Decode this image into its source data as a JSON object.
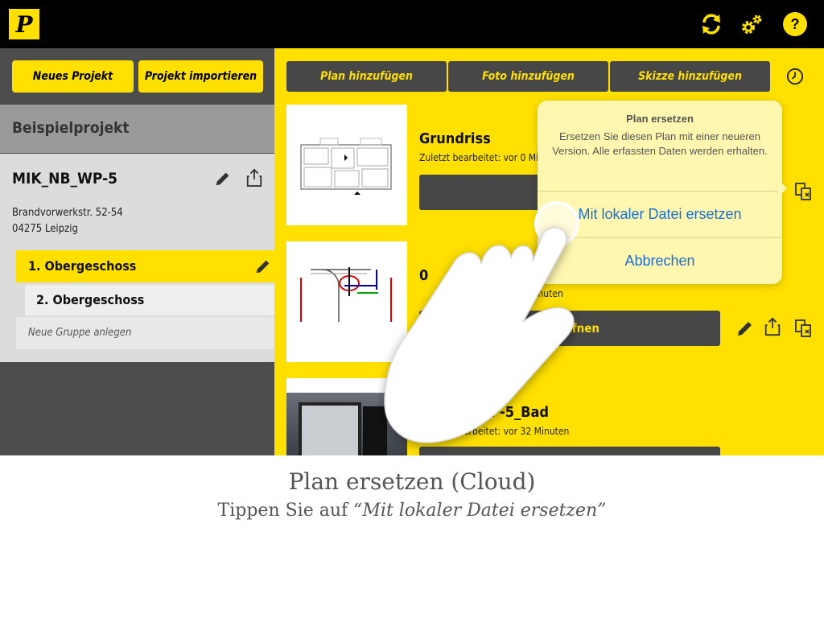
{
  "topbar": {
    "logo_letter": "P",
    "sync_icon": "sync-icon",
    "settings_icon": "gears-icon",
    "help_label": "?"
  },
  "sidebar": {
    "new_project": "Neues Projekt",
    "import_project": "Projekt importieren",
    "project_header": "Beispielprojekt",
    "project": {
      "name": "MIK_NB_WP-5",
      "address_line1": "Brandvorwerkstr. 52-54",
      "address_line2": "04275 Leipzig"
    },
    "floors": [
      {
        "label": "1. Obergeschoss",
        "selected": true
      },
      {
        "label": "2. Obergeschoss",
        "selected": false
      }
    ],
    "new_group": "Neue Gruppe anlegen"
  },
  "toolbar": {
    "add_plan": "Plan hinzufügen",
    "add_photo": "Foto hinzufügen",
    "add_sketch": "Skizze hinzufügen",
    "history_icon": "clock-icon"
  },
  "plans": [
    {
      "title": "Grundriss",
      "meta": "Zuletzt bearbeitet: vor 0 Mi"
    },
    {
      "title": "0",
      "meta": "/ Minuten",
      "open_label": "öffnen"
    },
    {
      "title": "K_NB_WP-5_Bad",
      "meta": "Zuletzt bearbeitet: vor 32 Minuten"
    }
  ],
  "popover": {
    "title": "Plan ersetzen",
    "message": "Ersetzen Sie diesen Plan mit einer neueren Version. Alle erfassten Daten werden erhalten.",
    "action_replace": "Mit lokaler Datei ersetzen",
    "action_cancel": "Abbrechen"
  },
  "caption": {
    "title": "Plan ersetzen (Cloud)",
    "sub_prefix": "Tippen Sie auf ",
    "sub_quote": "“Mit lokaler Datei ersetzen”"
  },
  "colors": {
    "accent_yellow": "#ffe000",
    "dark": "#474747",
    "link_blue": "#1a6fd6"
  }
}
